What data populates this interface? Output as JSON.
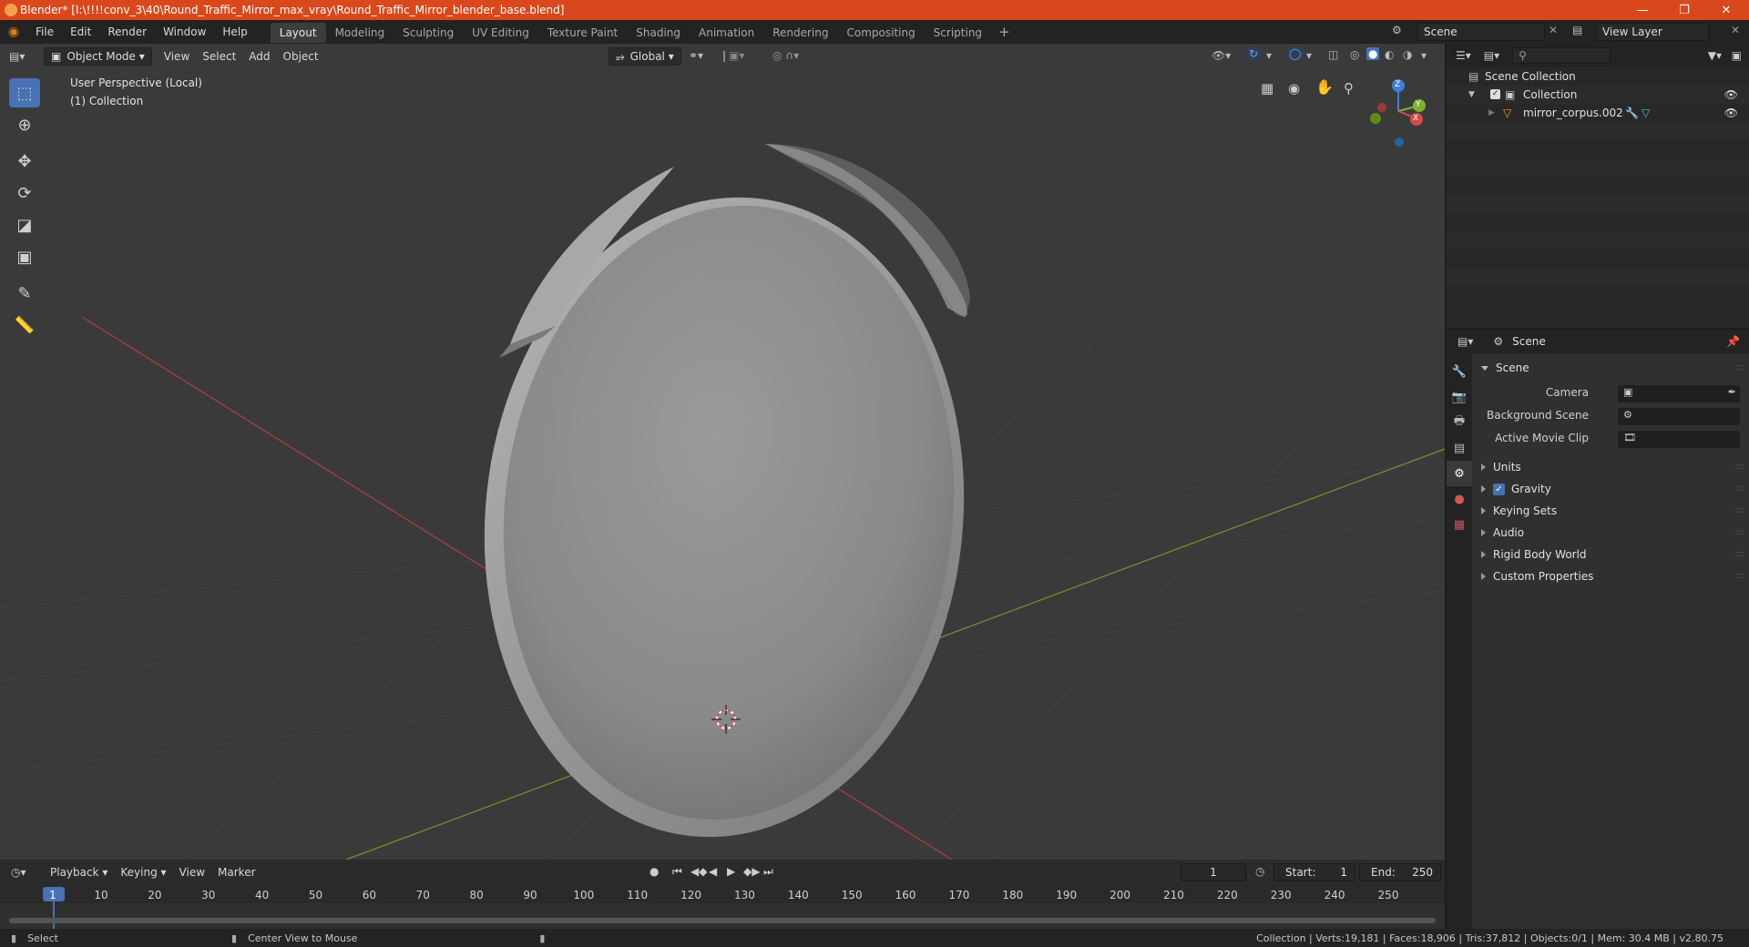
{
  "window": {
    "title": "Blender* [I:\\!!!!conv_3\\40\\Round_Traffic_Mirror_max_vray\\Round_Traffic_Mirror_blender_base.blend]"
  },
  "menu": [
    "File",
    "Edit",
    "Render",
    "Window",
    "Help"
  ],
  "workspaces": [
    "Layout",
    "Modeling",
    "Sculpting",
    "UV Editing",
    "Texture Paint",
    "Shading",
    "Animation",
    "Rendering",
    "Compositing",
    "Scripting"
  ],
  "active_workspace": "Layout",
  "scene_field": "Scene",
  "view_layer_field": "View Layer",
  "viewport": {
    "mode": "Object Mode",
    "menus": [
      "View",
      "Select",
      "Add",
      "Object"
    ],
    "transform_orientation": "Global",
    "info_line1": "User Perspective (Local)",
    "info_line2": "(1) Collection",
    "gizmo": {
      "z": "Z",
      "y": "Y",
      "x": "X"
    }
  },
  "outliner": {
    "root": "Scene Collection",
    "collection": "Collection",
    "object": "mirror_corpus.002"
  },
  "properties": {
    "header": "Scene",
    "section": "Scene",
    "fields": [
      {
        "label": "Camera"
      },
      {
        "label": "Background Scene"
      },
      {
        "label": "Active Movie Clip"
      }
    ],
    "panels": [
      "Units",
      "Gravity",
      "Keying Sets",
      "Audio",
      "Rigid Body World",
      "Custom Properties"
    ],
    "gravity_checked": true
  },
  "timeline": {
    "menus": [
      "Playback",
      "Keying",
      "View",
      "Marker"
    ],
    "current_frame": "1",
    "start_label": "Start:",
    "start": "1",
    "end_label": "End:",
    "end": "250",
    "ruler": [
      "1",
      "10",
      "20",
      "30",
      "40",
      "50",
      "60",
      "70",
      "80",
      "90",
      "100",
      "110",
      "120",
      "130",
      "140",
      "150",
      "160",
      "170",
      "180",
      "190",
      "200",
      "210",
      "220",
      "230",
      "240",
      "250"
    ]
  },
  "statusbar": {
    "left_action": "Select",
    "middle_action": "Center View to Mouse",
    "stats": "Collection | Verts:19,181 | Faces:18,906 | Tris:37,812 | Objects:0/1 | Mem: 30.4 MB | v2.80.75"
  },
  "colors": {
    "titlebar": "#d9481c",
    "accent": "#4772b3",
    "viewport_bg": "#3a3a3a",
    "x_axis": "#b03a3a",
    "y_axis": "#6f8f2a"
  }
}
